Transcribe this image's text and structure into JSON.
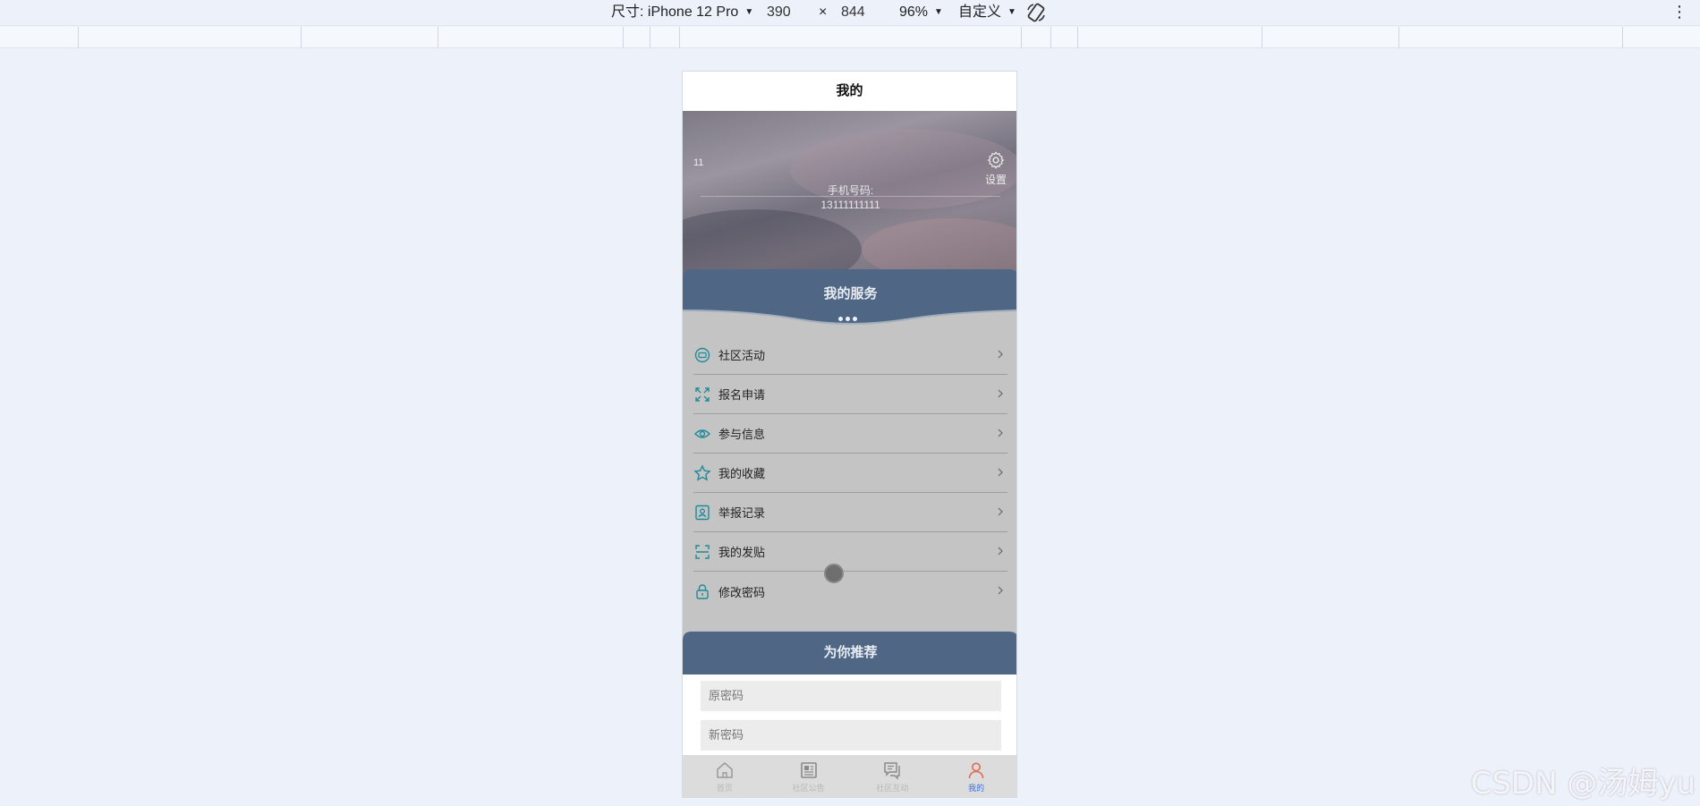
{
  "devtools": {
    "size_label": "尺寸: iPhone 12 Pro",
    "width": "390",
    "times": "×",
    "height": "844",
    "zoom": "96%",
    "custom": "自定义",
    "more": "⋮"
  },
  "page": {
    "nav_title": "我的",
    "username": "11",
    "phone_label": "手机号码:",
    "phone_number": "13111111111",
    "settings_label": "设置"
  },
  "services": {
    "title": "我的服务",
    "items": [
      {
        "label": "社区活动",
        "icon": "chat-bubble-icon"
      },
      {
        "label": "报名申请",
        "icon": "expand-icon"
      },
      {
        "label": "参与信息",
        "icon": "eye-icon"
      },
      {
        "label": "我的收藏",
        "icon": "star-icon"
      },
      {
        "label": "举报记录",
        "icon": "contact-card-icon"
      },
      {
        "label": "我的发贴",
        "icon": "scan-icon"
      },
      {
        "label": "修改密码",
        "icon": "lock-icon"
      }
    ]
  },
  "recommend": {
    "title": "为你推荐"
  },
  "form": {
    "old_password_placeholder": "原密码",
    "new_password_placeholder": "新密码"
  },
  "tabbar": {
    "items": [
      {
        "label": "首页",
        "icon": "home-icon"
      },
      {
        "label": "社区公告",
        "icon": "newspaper-icon"
      },
      {
        "label": "社区互动",
        "icon": "comments-icon"
      },
      {
        "label": "我的",
        "icon": "user-icon"
      }
    ]
  },
  "watermark": "CSDN @汤姆yu",
  "colors": {
    "header_blue": "#4f6784",
    "icon_teal": "#1f8a98",
    "active_tab": "#3c6fd8",
    "active_icon": "#e06a55"
  }
}
